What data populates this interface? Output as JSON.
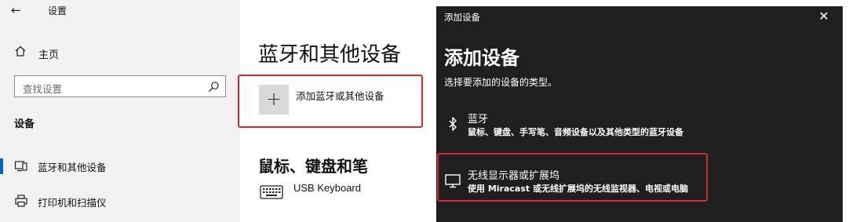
{
  "settings": {
    "app_title": "设置",
    "home_label": "主页",
    "search": {
      "placeholder": "查找设置"
    },
    "section_heading": "设备",
    "nav_items": [
      {
        "label": "蓝牙和其他设备",
        "icon": "bluetooth-devices-icon",
        "selected": true
      },
      {
        "label": "打印机和扫描仪",
        "icon": "printer-icon",
        "selected": false
      }
    ],
    "accent_color": "#0067c0"
  },
  "content": {
    "page_title": "蓝牙和其他设备",
    "add_device_label": "添加蓝牙或其他设备",
    "section_keyboard": "鼠标、键盘和笔",
    "keyboard_device": "USB Keyboard"
  },
  "dialog": {
    "window_title": "添加设备",
    "heading": "添加设备",
    "subtitle": "选择要添加的设备的类型。",
    "options": [
      {
        "title": "蓝牙",
        "description": "鼠标、键盘、手写笔、音频设备以及其他类型的蓝牙设备",
        "icon": "bluetooth-icon"
      },
      {
        "title": "无线显示器或扩展坞",
        "description": "使用 Miracast 或无线扩展坞的无线监视器、电视或电脑",
        "icon": "monitor-icon"
      }
    ],
    "background_color": "#1f1f1f"
  },
  "highlight_color": "#d8282c"
}
